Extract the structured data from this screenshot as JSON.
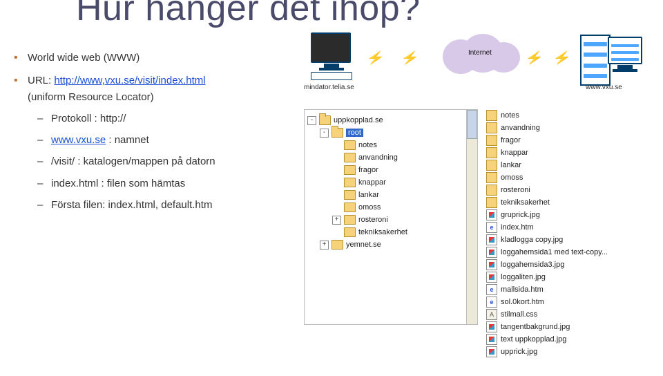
{
  "title": "Hur hänger det ihop?",
  "bullets": {
    "b1": "World wide web (WWW)",
    "b2_prefix": "URL: ",
    "b2_link": "http://www,vxu.se/visit/index.html",
    "b2_suffix": " (uniform Resource Locator)",
    "sub1": "Protokoll : http://",
    "sub2_link": "www.vxu.se",
    "sub2_suffix": " : namnet",
    "sub3": "/visit/ : katalogen/mappen på datorn",
    "sub4": "index.html : filen som hämtas",
    "sub5": "Första filen: index.html, default.htm"
  },
  "diagram": {
    "left_caption": "mindator.telia.se",
    "cloud_label": "Internet",
    "right_caption": "www.vxu.se"
  },
  "tree": [
    {
      "indent": 0,
      "toggle": "-",
      "open": true,
      "label": "uppkopplad.se"
    },
    {
      "indent": 1,
      "toggle": "-",
      "open": true,
      "label": "root",
      "selected": true
    },
    {
      "indent": 2,
      "toggle": "",
      "open": false,
      "label": "notes"
    },
    {
      "indent": 2,
      "toggle": "",
      "open": false,
      "label": "anvandning"
    },
    {
      "indent": 2,
      "toggle": "",
      "open": false,
      "label": "fragor"
    },
    {
      "indent": 2,
      "toggle": "",
      "open": false,
      "label": "knappar"
    },
    {
      "indent": 2,
      "toggle": "",
      "open": false,
      "label": "lankar"
    },
    {
      "indent": 2,
      "toggle": "",
      "open": false,
      "label": "omoss"
    },
    {
      "indent": 2,
      "toggle": "+",
      "open": false,
      "label": "rosteroni"
    },
    {
      "indent": 2,
      "toggle": "",
      "open": false,
      "label": "tekniksakerhet"
    },
    {
      "indent": 1,
      "toggle": "+",
      "open": false,
      "label": "yemnet.se"
    }
  ],
  "files": [
    {
      "type": "folder",
      "name": "notes"
    },
    {
      "type": "folder",
      "name": "anvandning"
    },
    {
      "type": "folder",
      "name": "fragor"
    },
    {
      "type": "folder",
      "name": "knappar"
    },
    {
      "type": "folder",
      "name": "lankar"
    },
    {
      "type": "folder",
      "name": "omoss"
    },
    {
      "type": "folder",
      "name": "rosteroni"
    },
    {
      "type": "folder",
      "name": "tekniksakerhet"
    },
    {
      "type": "img",
      "name": "gruprick.jpg"
    },
    {
      "type": "html",
      "name": "index.htm"
    },
    {
      "type": "img",
      "name": "kladlogga copy.jpg"
    },
    {
      "type": "img",
      "name": "loggahemsida1 med text-copy..."
    },
    {
      "type": "img",
      "name": "loggahemsida3.jpg"
    },
    {
      "type": "img",
      "name": "loggaliten.jpg"
    },
    {
      "type": "html",
      "name": "mallsida.htm"
    },
    {
      "type": "html",
      "name": "sol.0kort.htm"
    },
    {
      "type": "css",
      "name": "stilmall.css"
    },
    {
      "type": "img",
      "name": "tangentbakgrund.jpg"
    },
    {
      "type": "img",
      "name": "text uppkopplad.jpg"
    },
    {
      "type": "img",
      "name": "upprick.jpg"
    }
  ]
}
